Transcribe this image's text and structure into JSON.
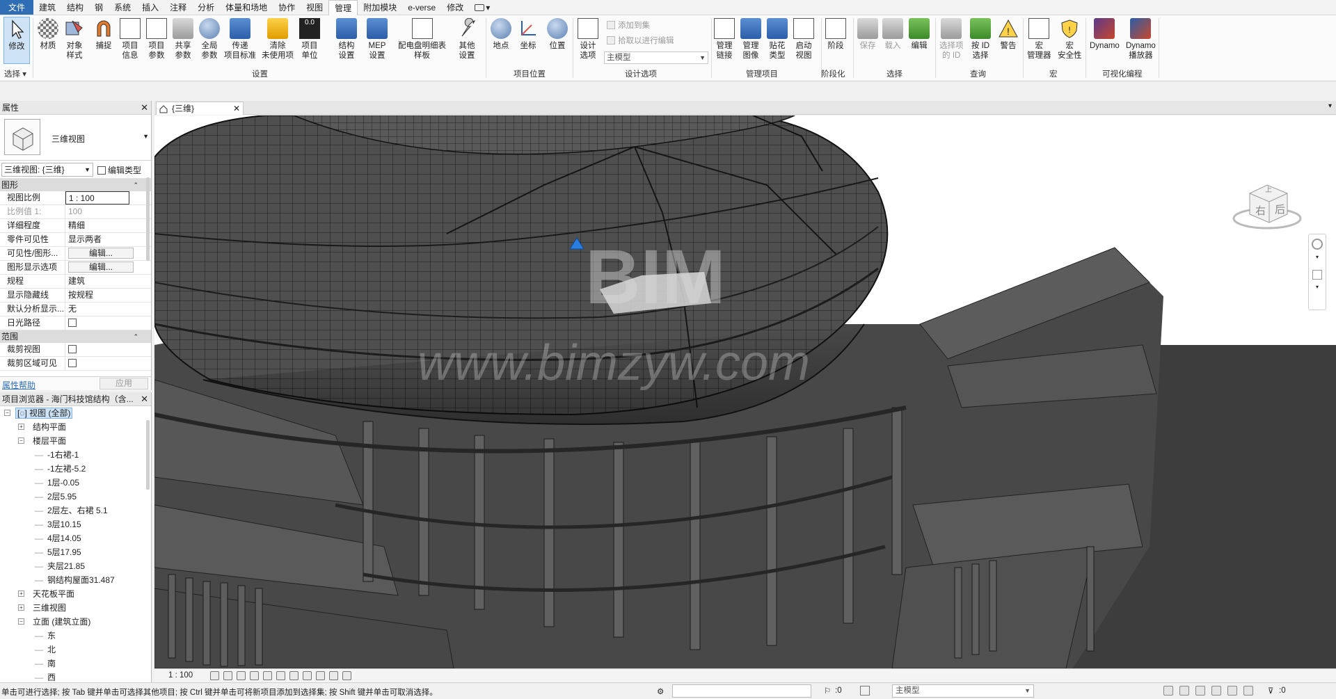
{
  "tabs": [
    "文件",
    "建筑",
    "结构",
    "钢",
    "系统",
    "插入",
    "注释",
    "分析",
    "体量和场地",
    "协作",
    "视图",
    "管理",
    "附加模块",
    "e-verse",
    "修改"
  ],
  "ribbon": {
    "modify": "修改",
    "select_group": "选择",
    "settings": {
      "materials": "材质",
      "object_styles_1": "对象",
      "object_styles_2": "样式",
      "snaps": "捕捉",
      "project_info_1": "项目",
      "project_info_2": "信息",
      "project_params_1": "项目",
      "project_params_2": "参数",
      "shared_params_1": "共享",
      "shared_params_2": "参数",
      "global_params_1": "全局",
      "global_params_2": "参数",
      "transfer_1": "传递",
      "transfer_2": "项目标准",
      "purge_1": "清除",
      "purge_2": "未使用项",
      "units_1": "项目",
      "units_2": "单位",
      "struct_1": "结构",
      "struct_2": "设置",
      "mep_1": "MEP",
      "mep_2": "设置",
      "panel_1": "配电盘明细表",
      "panel_2": "样板",
      "other_1": "其他",
      "other_2": "设置",
      "group": "设置"
    },
    "location": {
      "location": "地点",
      "coordinates": "坐标",
      "position": "位置",
      "group": "项目位置"
    },
    "design_options": {
      "options_1": "设计",
      "options_2": "选项",
      "add_to_set": "添加到集",
      "pick_to_edit": "拾取以进行编辑",
      "main_model": "主模型",
      "group": "设计选项"
    },
    "manage_project": {
      "links_1": "管理",
      "links_2": "链接",
      "images_1": "管理",
      "images_2": "图像",
      "decal_1": "贴花",
      "decal_2": "类型",
      "startup_1": "启动",
      "startup_2": "视图",
      "group": "管理项目"
    },
    "phasing": {
      "phases": "阶段",
      "group": "阶段化"
    },
    "selection": {
      "save": "保存",
      "load": "载入",
      "edit": "编辑",
      "group": "选择"
    },
    "inquiry": {
      "ids_1": "选择项",
      "ids_2": "的 ID",
      "by_id_1": "按 ID",
      "by_id_2": "选择",
      "warnings": "警告",
      "group": "查询"
    },
    "macros": {
      "manager_1": "宏",
      "manager_2": "管理器",
      "security_1": "宏",
      "security_2": "安全性",
      "group": "宏"
    },
    "visual_programming": {
      "dynamo": "Dynamo",
      "player_1": "Dynamo",
      "player_2": "播放器",
      "group": "可视化编程"
    }
  },
  "properties": {
    "title": "属性",
    "type_name": "三维视图",
    "instance_filter": "三维视图: {三维}",
    "edit_type": "编辑类型",
    "sections": {
      "graphics": "图形",
      "extents": "范围"
    },
    "graphics_rows": [
      {
        "key": "视图比例",
        "value": "1 : 100"
      },
      {
        "key": "比例值 1:",
        "value": "100"
      },
      {
        "key": "详细程度",
        "value": "精细"
      },
      {
        "key": "零件可见性",
        "value": "显示两者"
      },
      {
        "key": "可见性/图形...",
        "value": "编辑..."
      },
      {
        "key": "图形显示选项",
        "value": "编辑..."
      },
      {
        "key": "规程",
        "value": "建筑"
      },
      {
        "key": "显示隐藏线",
        "value": "按规程"
      },
      {
        "key": "默认分析显示...",
        "value": "无"
      },
      {
        "key": "日光路径",
        "value": ""
      }
    ],
    "extents_rows": [
      {
        "key": "裁剪视图",
        "value": ""
      },
      {
        "key": "裁剪区域可见",
        "value": ""
      }
    ],
    "help": "属性帮助",
    "apply": "应用"
  },
  "browser": {
    "title": "项目浏览器 - 海门科技馆结构（含...",
    "root": "视图 (全部)",
    "structural_plans": "结构平面",
    "floor_plans": "楼层平面",
    "floors": [
      "-1右裙-1",
      "-1左裙-5.2",
      "1层-0.05",
      "2层5.95",
      "2层左、右裙 5.1",
      "3层10.15",
      "4层14.05",
      "5层17.95",
      "夹层21.85",
      "钢结构屋面31.487"
    ],
    "ceiling_plans": "天花板平面",
    "views_3d": "三维视图",
    "elevations": "立面 (建筑立面)",
    "elev_items": [
      "东",
      "北",
      "南",
      "西"
    ]
  },
  "view": {
    "tab_label": "{三维}",
    "cube_top": "上",
    "cube_right": "右",
    "cube_back": "后",
    "watermark_1": "BIM",
    "watermark_2": "www.bimzyw.com",
    "scale": "1 : 100"
  },
  "status": {
    "message": "单击可进行选择; 按 Tab 键并单击可选择其他项目; 按 Ctrl 键并单击可将新项目添加到选择集; 按 Shift 键并单击可取消选择。",
    "zero_1": ":0",
    "main_model": "主模型",
    "filter": ":0"
  },
  "colors": {
    "file_tab": "#2f6db5",
    "selection": "#cfe3f7",
    "model": "#4a4a4a"
  }
}
